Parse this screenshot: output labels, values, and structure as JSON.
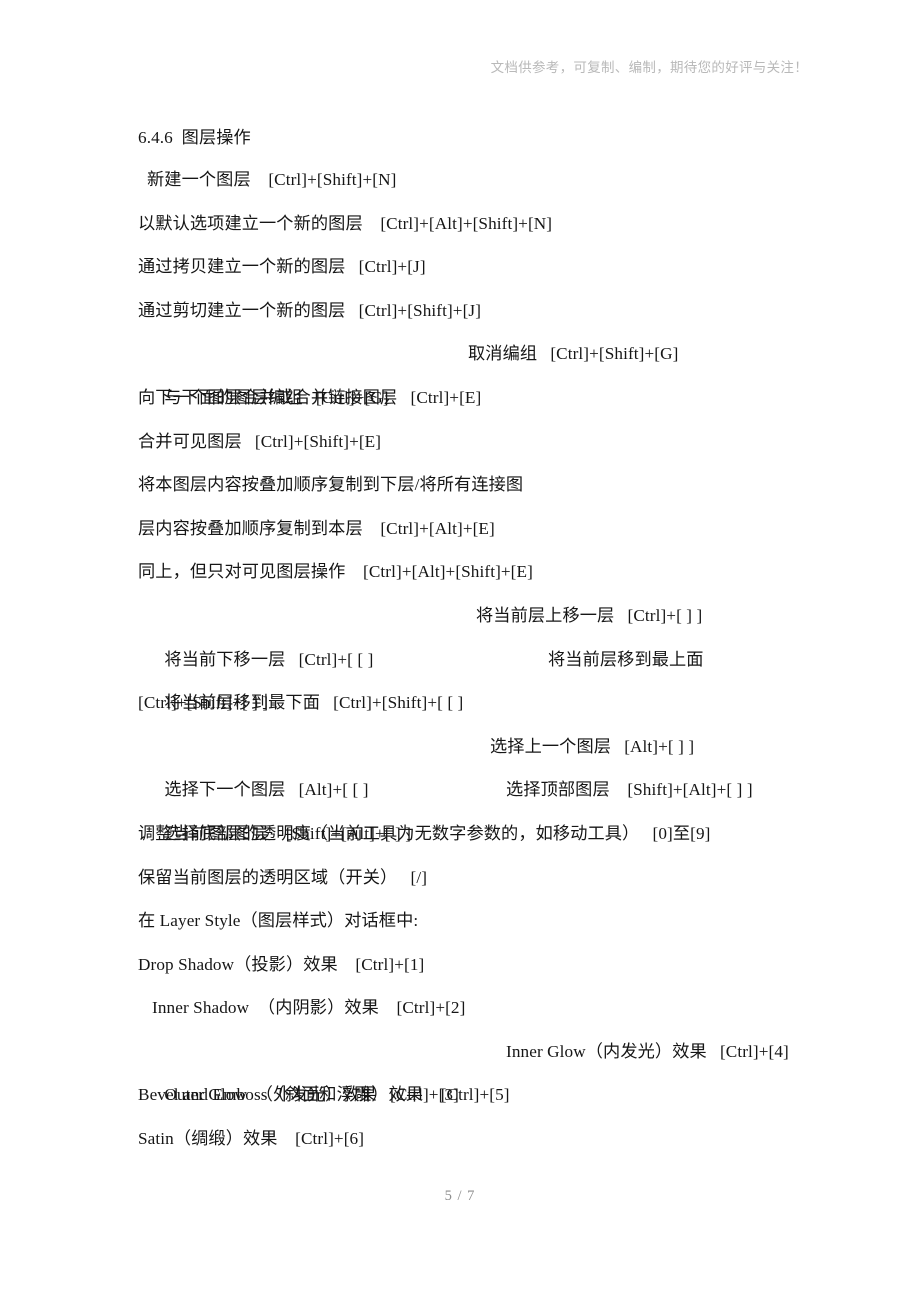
{
  "header": {
    "note": "文档供参考，可复制、编制，期待您的好评与关注！"
  },
  "footer": {
    "page_indicator": "5 / 7"
  },
  "content": {
    "heading": "6.4.6  图层操作",
    "lines": [
      {
        "text": "新建一个图层    [Ctrl]+[Shift]+[N]"
      },
      {
        "text": "以默认选项建立一个新的图层    [Ctrl]+[Alt]+[Shift]+[N]"
      },
      {
        "text": "通过拷贝建立一个新的图层   [Ctrl]+[J]"
      },
      {
        "text": "通过剪切建立一个新的图层   [Ctrl]+[Shift]+[J]"
      },
      {
        "left": "与下面的图层编组   [Ctrl]+[G]",
        "right": "取消编组   [Ctrl]+[Shift]+[G]"
      },
      {
        "text": "向下一个图层合并或合并链接图层   [Ctrl]+[E]"
      },
      {
        "text": "合并可见图层   [Ctrl]+[Shift]+[E]"
      },
      {
        "text": "将本图层内容按叠加顺序复制到下层/将所有连接图"
      },
      {
        "text": "层内容按叠加顺序复制到本层    [Ctrl]+[Alt]+[E]"
      },
      {
        "text": "同上，但只对可见图层操作    [Ctrl]+[Alt]+[Shift]+[E]"
      },
      {
        "left": "将当前下移一层   [Ctrl]+[ [ ]",
        "right": "将当前层上移一层   [Ctrl]+[ ] ]"
      },
      {
        "left": "将当前层移到最下面   [Ctrl]+[Shift]+[ [ ]",
        "right": "将当前层移到最上面"
      },
      {
        "text": "[Ctrl]+[Shift]+[ ] ]"
      },
      {
        "left": "选择下一个图层   [Alt]+[ [ ]",
        "right": "选择上一个图层   [Alt]+[ ] ]"
      },
      {
        "left": "选择底部图层    [Shift]+[Alt]+[ ] ]",
        "right": "选择顶部图层    [Shift]+[Alt]+[ ] ]"
      },
      {
        "text": "调整当前图层的透明度（当前工具为无数字参数的，如移动工具）   [0]至[9]"
      },
      {
        "text": "保留当前图层的透明区域（开关）   [/]"
      },
      {
        "text": "在 Layer Style（图层样式）对话框中:"
      },
      {
        "text": "Drop Shadow（投影）效果    [Ctrl]+[1]"
      },
      {
        "text": "Inner Shadow  （内阴影）效果    [Ctrl]+[2]"
      },
      {
        "left": "Outer Glow  （外发光）效果   [Ctrl]+[3]",
        "right": "Inner Glow（内发光）效果   [Ctrl]+[4]"
      },
      {
        "text": "Bevel and Emboss（斜面和浮雕）效果    [Ctrl]+[5]"
      },
      {
        "text": "Satin（绸缎）效果    [Ctrl]+[6]"
      }
    ]
  }
}
